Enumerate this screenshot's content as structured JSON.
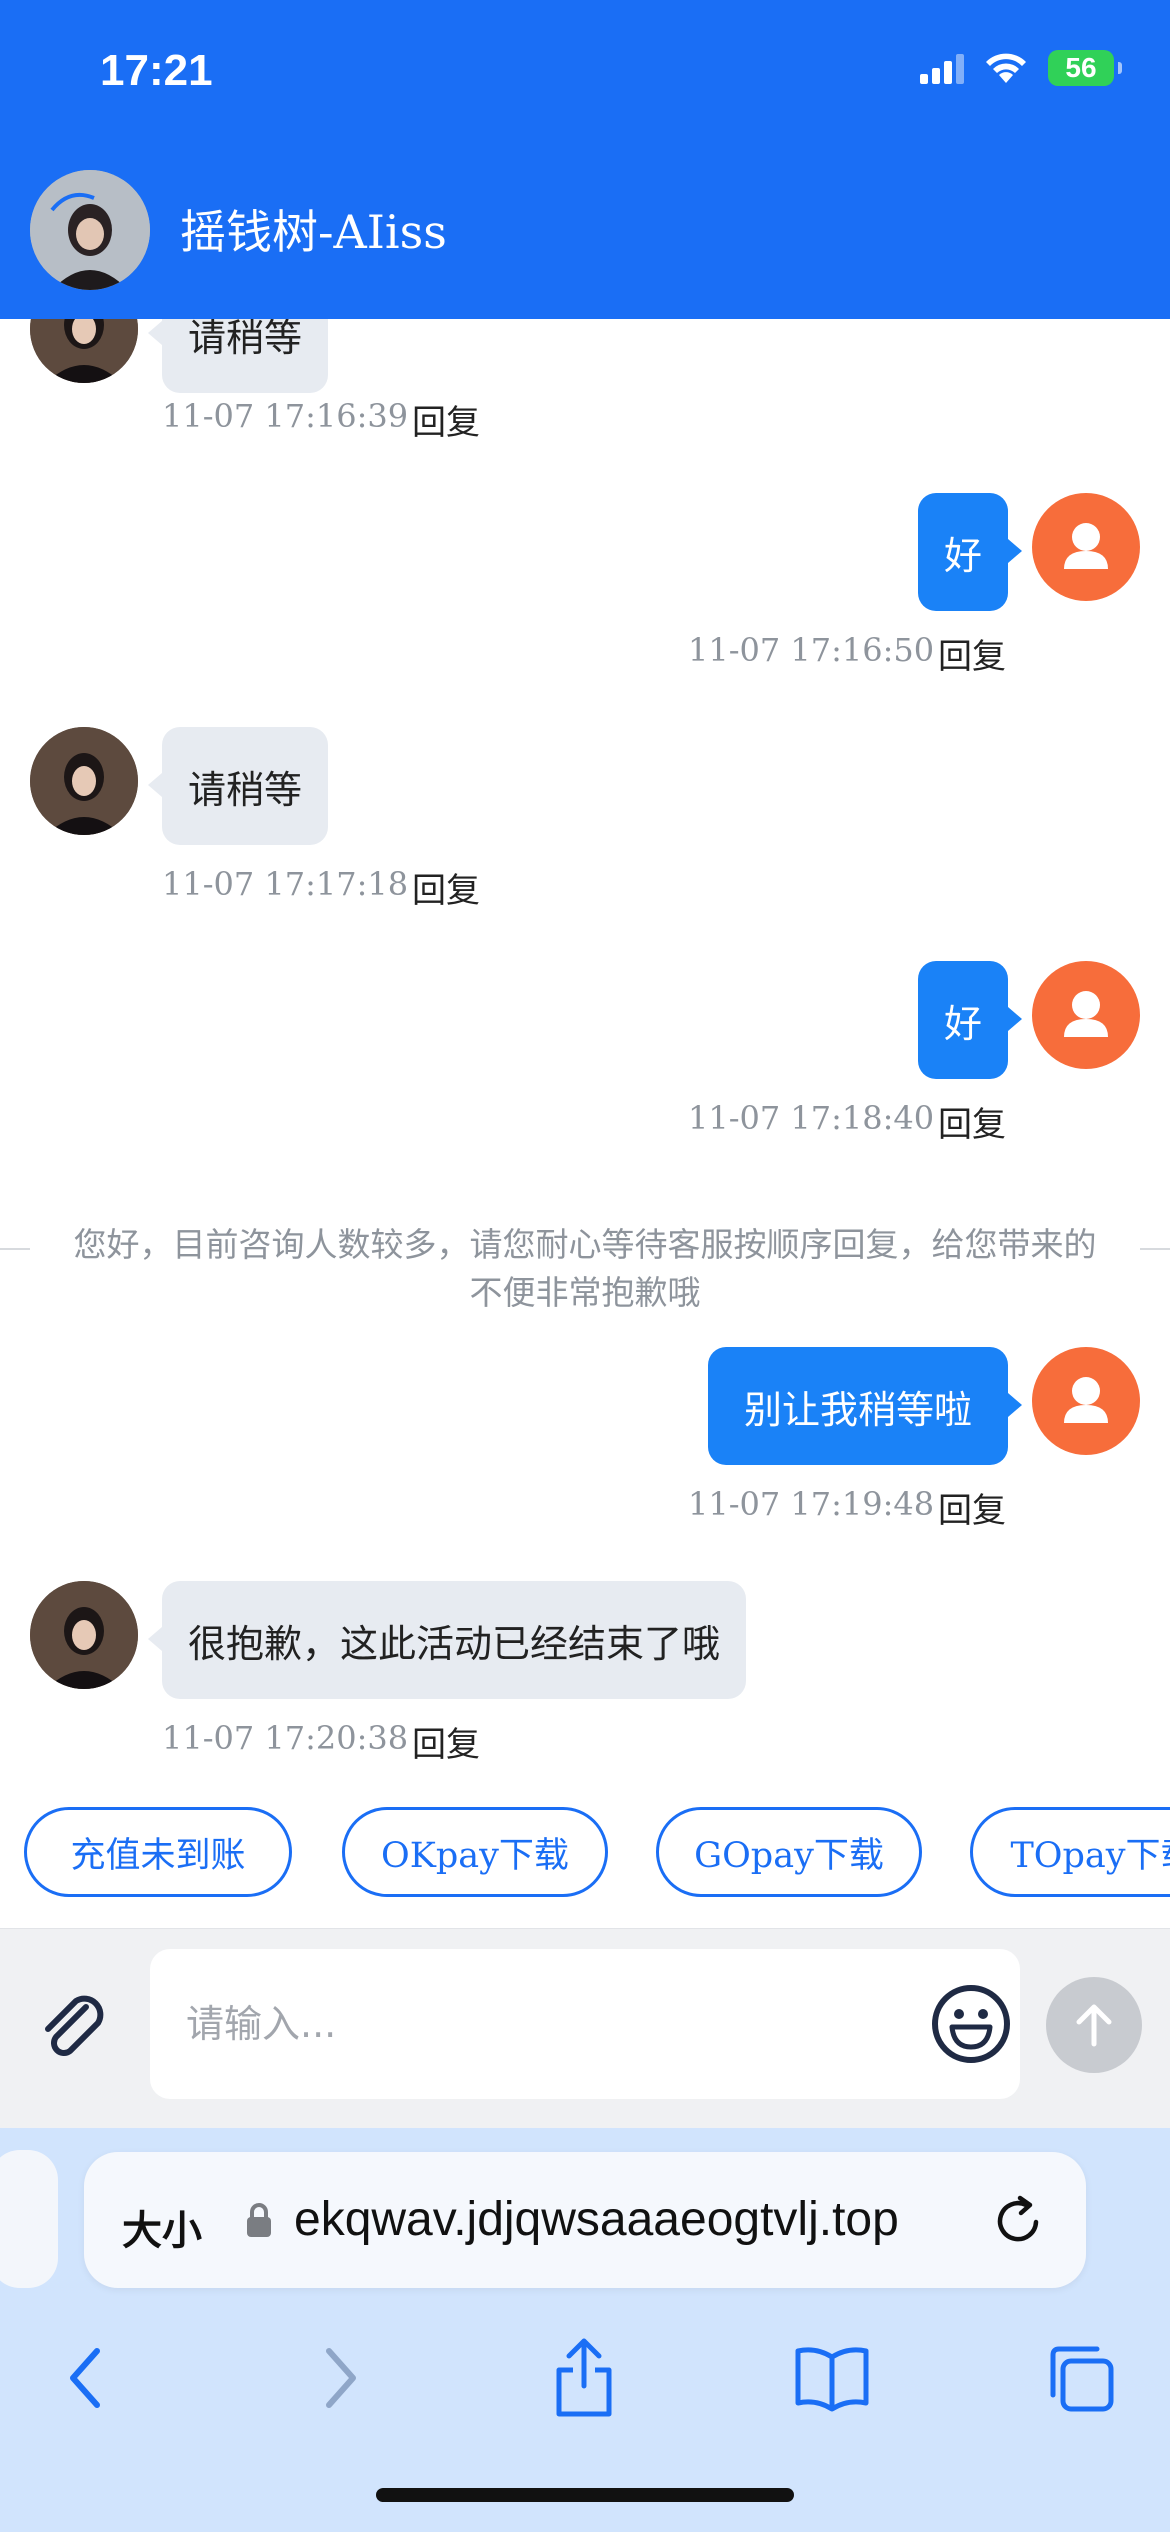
{
  "status_bar": {
    "time": "17:21",
    "battery": "56"
  },
  "header": {
    "title": "摇钱树-AIiss"
  },
  "messages": [
    {
      "side": "left",
      "text": "请稍等",
      "time": "11-07 17:16:39",
      "reply": "回复"
    },
    {
      "side": "right",
      "text": "好",
      "time": "11-07 17:16:50",
      "reply": "回复"
    },
    {
      "side": "left",
      "text": "请稍等",
      "time": "11-07 17:17:18",
      "reply": "回复"
    },
    {
      "side": "right",
      "text": "好",
      "time": "11-07 17:18:40",
      "reply": "回复"
    },
    {
      "side": "system",
      "text": "您好，目前咨询人数较多，请您耐心等待客服按顺序回复，给您带来的不便非常抱歉哦"
    },
    {
      "side": "right",
      "text": "别让我稍等啦",
      "time": "11-07 17:19:48",
      "reply": "回复"
    },
    {
      "side": "left",
      "text": "很抱歉，这此活动已经结束了哦",
      "time": "11-07 17:20:38",
      "reply": "回复"
    }
  ],
  "quick_replies": [
    "充值未到账",
    "OKpay下载",
    "GOpay下载",
    "TOpay下载"
  ],
  "composer": {
    "placeholder": "请输入..."
  },
  "browser": {
    "text_size_label": "大小",
    "url": "ekqwav.jdjqwsaaaeogtvlj.top"
  },
  "colors": {
    "header": "#1a6ef5",
    "bubble_right": "#1a82f7",
    "bubble_left": "#e7ebf1",
    "avatar_user": "#f76d3b"
  },
  "icons": [
    "signal-icon",
    "wifi-icon",
    "battery-icon",
    "paperclip-icon",
    "emoji-icon",
    "send-arrow-icon",
    "lock-icon",
    "reload-icon",
    "back-icon",
    "forward-icon",
    "share-icon",
    "bookmarks-icon",
    "tabs-icon",
    "user-avatar-icon"
  ]
}
